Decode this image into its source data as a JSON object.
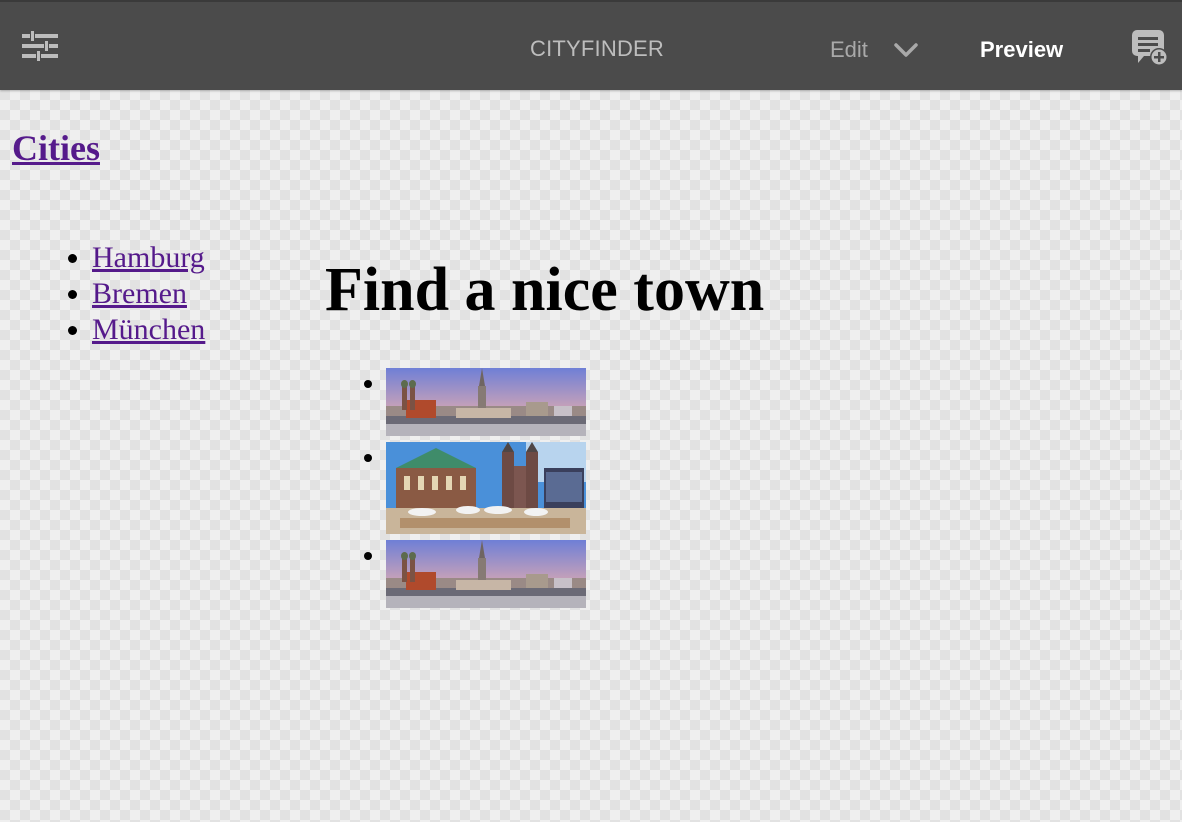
{
  "toolbar": {
    "app_title": "CITYFINDER",
    "edit_label": "Edit",
    "preview_label": "Preview",
    "left_icon": "sliders-icon",
    "mode_icon": "chevron-down-icon",
    "right_icon": "add-annotation-icon"
  },
  "page": {
    "title_link": "Cities",
    "heading": "Find a nice town"
  },
  "sidebar": {
    "items": [
      {
        "label": "Hamburg"
      },
      {
        "label": "Bremen"
      },
      {
        "label": "München"
      }
    ]
  },
  "cities": {
    "items": [
      {
        "image": "munich-skyline-thumbnail"
      },
      {
        "image": "bremen-market-square-thumbnail"
      },
      {
        "image": "munich-skyline-thumbnail"
      }
    ]
  },
  "colors": {
    "toolbar_bg": "#4b4b4b",
    "link": "#551a8b",
    "preview_active": "#ffffff"
  }
}
